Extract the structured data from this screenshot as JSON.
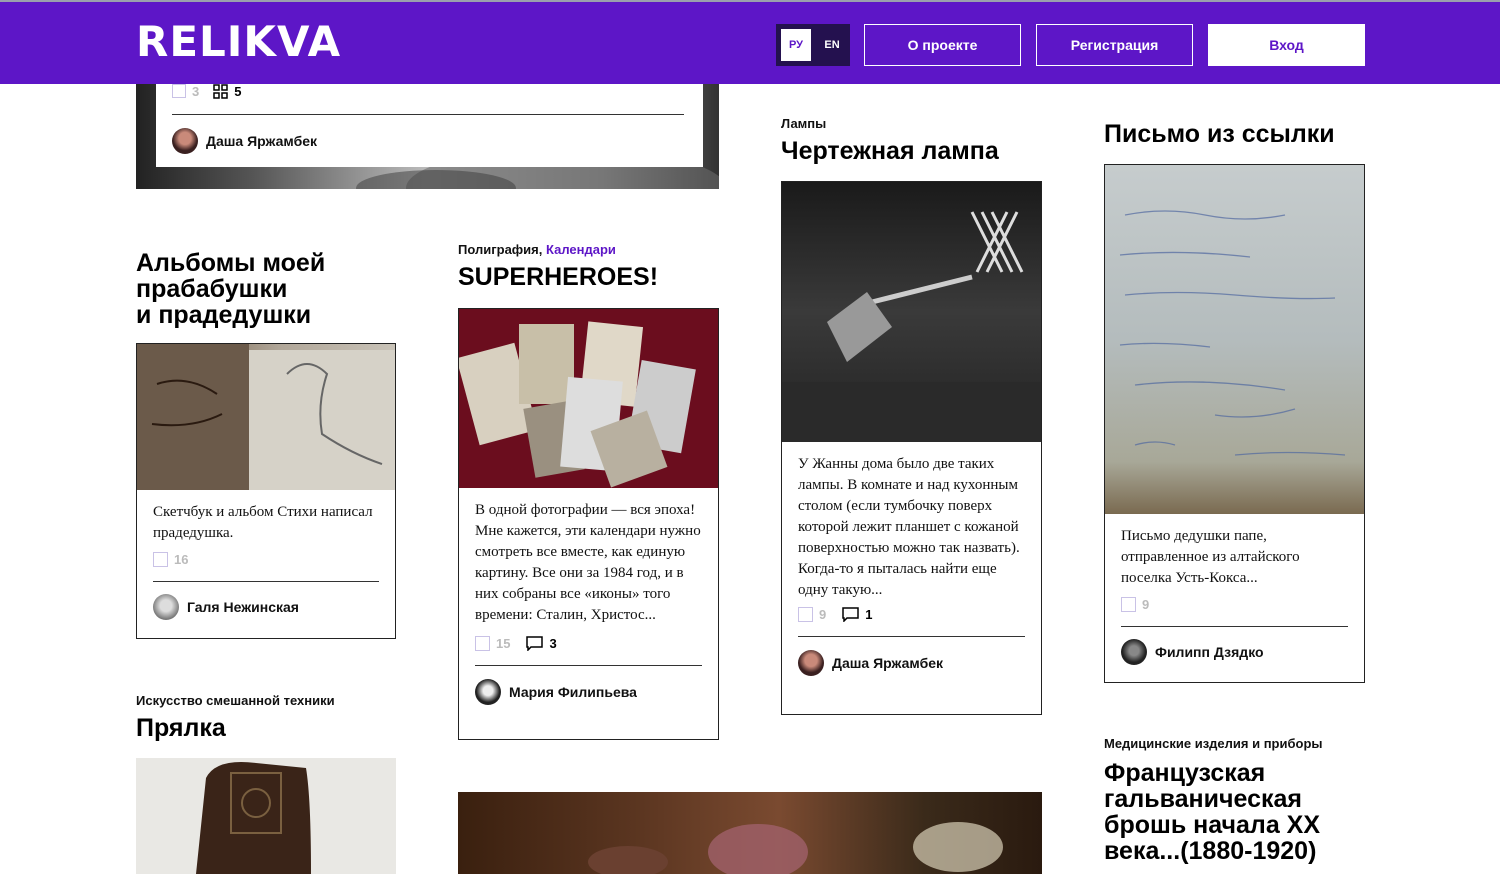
{
  "header": {
    "logo": "RELIKVA",
    "lang": [
      "РУ",
      "EN"
    ],
    "about": "О проекте",
    "register": "Регистрация",
    "login": "Вход",
    "color": "#5d16c7"
  },
  "top_card": {
    "likes": "3",
    "photos": "5",
    "author": "Даша Яржамбек"
  },
  "cards": {
    "albums": {
      "title_lines": [
        "Альбомы моей",
        "прабабушки",
        "и прадедушки"
      ],
      "desc": "Скетчбук и альбом Стихи написал прадедушка.",
      "likes": "16",
      "author": "Галя Нежинская"
    },
    "heroes": {
      "cat1": "Полиграфия,",
      "cat2": "Календари",
      "title": "SUPERHEROES!",
      "desc": "В одной фотографии — вся эпоха! Мне кажется, эти календари нужно смотреть все вместе, как единую картину. Все они за 1984 год, и в них собраны все «иконы» того времени: Сталин, Христос...",
      "likes": "15",
      "comments": "3",
      "author": "Мария Филипьева"
    },
    "lamp": {
      "cat": "Лампы",
      "title": "Чертежная лампа",
      "desc": "У Жанны дома было две таких лампы. В комнате и над кухонным столом (если тумбочку поверх которой лежит планшет с кожаной поверхностью можно так назвать). Когда-то я пыталась найти еще одну такую...",
      "likes": "9",
      "comments": "1",
      "author": "Даша Яржамбек"
    },
    "letter": {
      "title": "Письмо из ссылки",
      "desc": "Письмо дедушки папе, отправленное из алтайского поселка Усть-Кокса...",
      "likes": "9",
      "author": "Филипп Дзядко"
    },
    "spindle": {
      "cat": "Искусство смешанной техники",
      "title": "Прялка"
    },
    "brooch": {
      "cat": "Медицинские изделия и приборы",
      "title_lines": [
        "Французская",
        "гальваническая",
        "брошь начала XX",
        "века...(1880-1920)"
      ]
    }
  }
}
